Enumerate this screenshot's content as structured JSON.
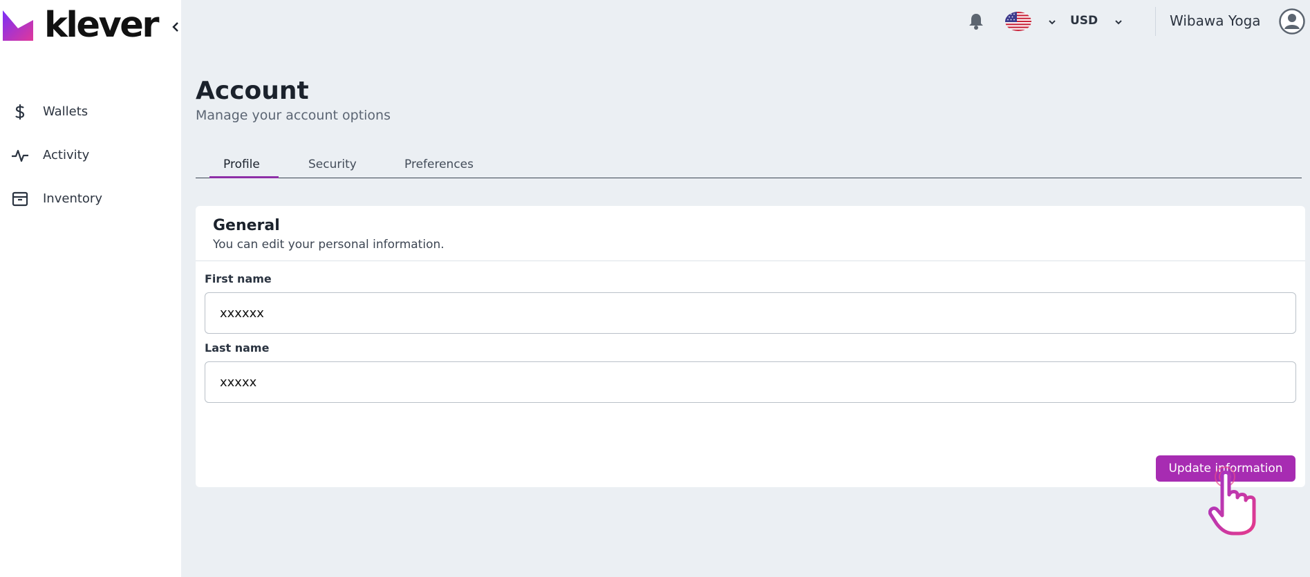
{
  "brand": {
    "name": "klever"
  },
  "sidebar": {
    "items": [
      {
        "label": "Wallets",
        "icon": "dollar-icon"
      },
      {
        "label": "Activity",
        "icon": "activity-pulse-icon"
      },
      {
        "label": "Inventory",
        "icon": "archive-box-icon"
      }
    ]
  },
  "header": {
    "language_flag": "us-flag-icon",
    "currency": "USD",
    "user_name": "Wibawa Yoga"
  },
  "page": {
    "title": "Account",
    "subtitle": "Manage your account options",
    "tabs": [
      {
        "label": "Profile",
        "active": true
      },
      {
        "label": "Security",
        "active": false
      },
      {
        "label": "Preferences",
        "active": false
      }
    ]
  },
  "general": {
    "title": "General",
    "description": "You can edit your personal information.",
    "first_name_label": "First name",
    "first_name_value": "xxxxxx",
    "last_name_label": "Last name",
    "last_name_value": "xxxxx",
    "update_label": "Update information"
  },
  "colors": {
    "accent": "#a72cb2",
    "tab_underline": "#8e2fa7",
    "background": "#ebeff3"
  }
}
